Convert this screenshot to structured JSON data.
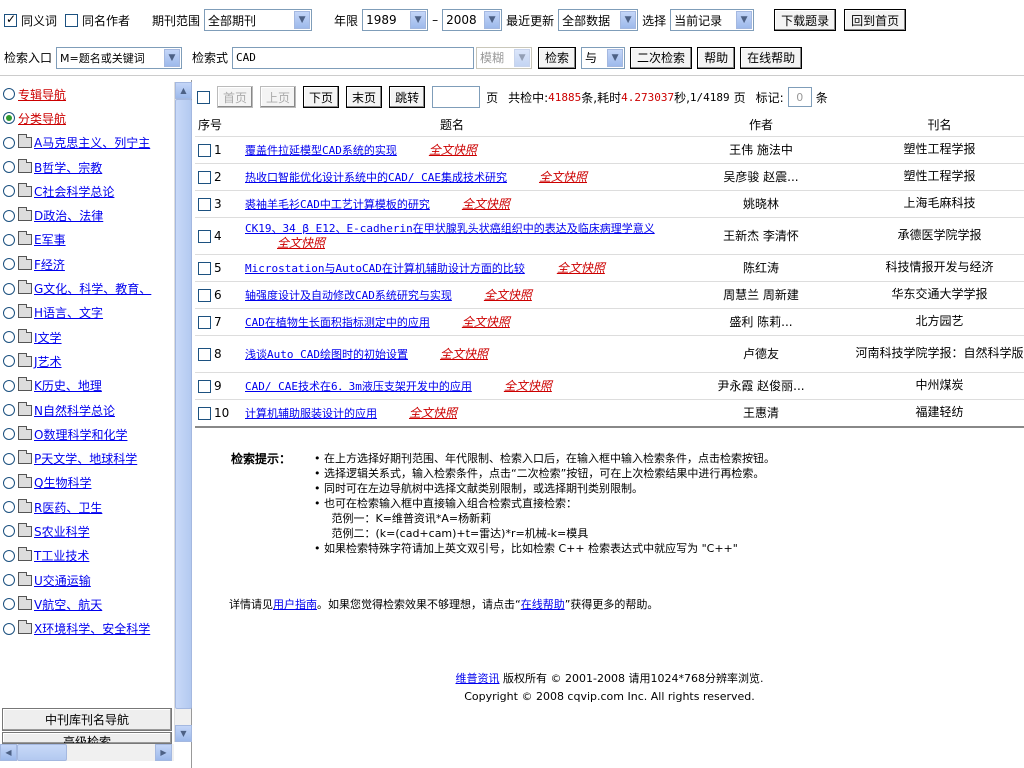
{
  "toolbar": {
    "synonym_label": "同义词",
    "same_author_label": "同名作者",
    "journal_range_label": "期刊范围",
    "journal_range_value": "全部期刊",
    "year_label": "年限",
    "year_from": "1989",
    "year_dash": "–",
    "year_to": "2008",
    "recent_label": "最近更新",
    "recent_value": "全部数据",
    "choose_label": "选择",
    "choose_value": "当前记录",
    "download_button": "下载题录",
    "home_button": "回到首页"
  },
  "search": {
    "entry_label": "检索入口",
    "entry_value": "M=题名或关键词",
    "expr_label": "检索式",
    "expr_value": "CAD",
    "fuzzy_value": "模糊",
    "search_button": "检索",
    "logic_value": "与",
    "secondary_button": "二次检索",
    "help_button": "帮助",
    "online_help_button": "在线帮助"
  },
  "sidebar": {
    "items": [
      {
        "label": "专辑导航",
        "style": "red",
        "radio": "off",
        "folder": false
      },
      {
        "label": "分类导航",
        "style": "red",
        "radio": "on",
        "folder": false
      },
      {
        "label": "A马克思主义、列宁主",
        "style": "blue",
        "radio": "off",
        "folder": true
      },
      {
        "label": "B哲学、宗教",
        "style": "blue",
        "radio": "off",
        "folder": true
      },
      {
        "label": "C社会科学总论",
        "style": "blue",
        "radio": "off",
        "folder": true
      },
      {
        "label": "D政治、法律",
        "style": "blue",
        "radio": "off",
        "folder": true
      },
      {
        "label": "E军事",
        "style": "blue",
        "radio": "off",
        "folder": true
      },
      {
        "label": "F经济",
        "style": "blue",
        "radio": "off",
        "folder": true
      },
      {
        "label": "G文化、科学、教育、",
        "style": "blue",
        "radio": "off",
        "folder": true
      },
      {
        "label": "H语言、文字",
        "style": "blue",
        "radio": "off",
        "folder": true
      },
      {
        "label": "I文学",
        "style": "blue",
        "radio": "off",
        "folder": true
      },
      {
        "label": "J艺术",
        "style": "blue",
        "radio": "off",
        "folder": true
      },
      {
        "label": "K历史、地理",
        "style": "blue",
        "radio": "off",
        "folder": true
      },
      {
        "label": "N自然科学总论",
        "style": "blue",
        "radio": "off",
        "folder": true
      },
      {
        "label": "O数理科学和化学",
        "style": "blue",
        "radio": "off",
        "folder": true
      },
      {
        "label": "P天文学、地球科学",
        "style": "blue",
        "radio": "off",
        "folder": true
      },
      {
        "label": "Q生物科学",
        "style": "blue",
        "radio": "off",
        "folder": true
      },
      {
        "label": "R医药、卫生",
        "style": "blue",
        "radio": "off",
        "folder": true
      },
      {
        "label": "S农业科学",
        "style": "blue",
        "radio": "off",
        "folder": true
      },
      {
        "label": "T工业技术",
        "style": "blue",
        "radio": "off",
        "folder": true
      },
      {
        "label": "U交通运输",
        "style": "blue",
        "radio": "off",
        "folder": true
      },
      {
        "label": "V航空、航天",
        "style": "blue",
        "radio": "off",
        "folder": true
      },
      {
        "label": "X环境科学、安全科学",
        "style": "blue",
        "radio": "off",
        "folder": true
      }
    ],
    "journal_nav_button": "中刊库刊名导航",
    "advanced_button": "高级检索"
  },
  "pager": {
    "first": "首页",
    "prev": "上页",
    "next": "下页",
    "last": "末页",
    "jump": "跳转",
    "page_unit": "页",
    "hits_prefix": "共检中:",
    "hits_count": "41885",
    "hits_unit": "条,耗时",
    "time_value": "4.273037",
    "time_unit": "秒,",
    "page_position": "1/4189",
    "page_label": "页",
    "mark_label": "标记:",
    "mark_count": "0",
    "mark_unit": "条"
  },
  "table": {
    "headers": {
      "seq": "序号",
      "title": "题名",
      "author": "作者",
      "journal": "刊名"
    },
    "full_text_label": "全文快照",
    "rows": [
      {
        "no": "1",
        "title": "覆盖件拉延模型CAD系统的实现",
        "author": "王伟 施法中",
        "journal": "塑性工程学报"
      },
      {
        "no": "2",
        "title": "热收口智能优化设计系统中的CAD/ CAE集成技术研究",
        "author": "吴彦骏 赵震...",
        "journal": "塑性工程学报"
      },
      {
        "no": "3",
        "title": "裘袖羊毛衫CAD中工艺计算模板的研究",
        "author": "姚晓林",
        "journal": "上海毛麻科技"
      },
      {
        "no": "4",
        "title": "CK19、34 β E12、E-cadherin在甲状腺乳头状癌组织中的表达及临床病理学意义",
        "author": "王新杰 李清怀",
        "journal": "承德医学院学报"
      },
      {
        "no": "5",
        "title": "Microstation与AutoCAD在计算机辅助设计方面的比较",
        "author": "陈红涛",
        "journal": "科技情报开发与经济"
      },
      {
        "no": "6",
        "title": "轴强度设计及自动修改CAD系统研究与实现",
        "author": "周慧兰 周新建",
        "journal": "华东交通大学学报"
      },
      {
        "no": "7",
        "title": "CAD在植物生长面积指标测定中的应用",
        "author": "盛利 陈莉...",
        "journal": "北方园艺"
      },
      {
        "no": "8",
        "title": "浅谈Auto CAD绘图时的初始设置",
        "author": "卢德友",
        "journal": "河南科技学院学报：自然科学版"
      },
      {
        "no": "9",
        "title": "CAD/ CAE技术在6．3m液压支架开发中的应用",
        "author": "尹永霞 赵俊丽...",
        "journal": "中州煤炭"
      },
      {
        "no": "10",
        "title": "计算机辅助服装设计的应用",
        "author": "王惠清",
        "journal": "福建轻纺"
      }
    ]
  },
  "help": {
    "title": "检索提示：",
    "lines": [
      "• 在上方选择好期刊范围、年代限制、检索入口后，在输入框中输入检索条件，点击检索按钮。",
      "• 选择逻辑关系式，输入检索条件，点击“二次检索”按钮，可在上次检索结果中进行再检索。",
      "• 同时可在左边导航树中选择文献类别限制，或选择期刊类别限制。",
      "• 也可在检索输入框中直接输入组合检索式直接检索：",
      "     范例一：K=维普资讯*A=杨新莉",
      "     范例二：(k=(cad+cam)+t=雷达)*r=机械-k=模具",
      "• 如果检索特殊字符请加上英文双引号，比如检索 C++ 检索表达式中就应写为 \"C++\""
    ],
    "detail_prefix": "详情请见",
    "user_guide_link": "用户指南",
    "detail_middle": "。如果您觉得检索效果不够理想，请点击“",
    "online_help_link": "在线帮助",
    "detail_suffix": "”获得更多的帮助。",
    "copyright_link": "维普资讯",
    "copyright_text": " 版权所有 © 2001-2008 请用1024*768分辨率浏览.",
    "copyright_line2": "Copyright © 2008 cqvip.com Inc. All rights reserved."
  },
  "colors": {
    "link": "#0000ee",
    "accent_red": "#cc0000",
    "scroll_blue": "#b3c9f0"
  }
}
